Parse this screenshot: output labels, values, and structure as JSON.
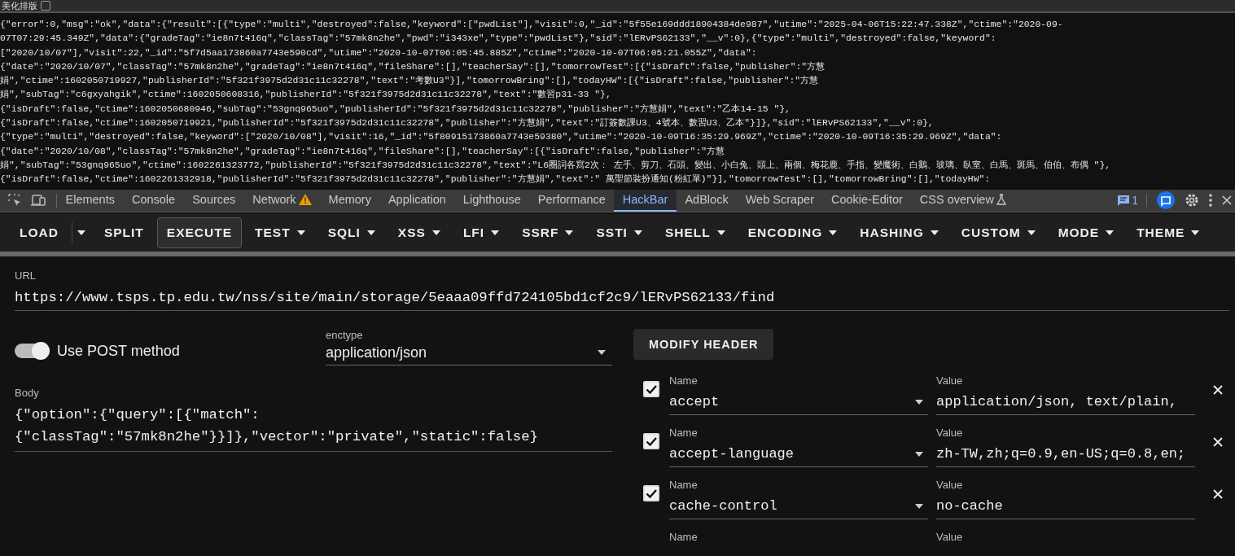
{
  "beautify": {
    "label": "美化排版",
    "checked": false
  },
  "response_lines": [
    "{\"error\":0,\"msg\":\"ok\",\"data\":{\"result\":[{\"type\":\"multi\",\"destroyed\":false,\"keyword\":[\"pwdList\"],\"visit\":0,\"_id\":\"5f55e169ddd18904384de987\",\"utime\":\"2025-04-06T15:22:47.338Z\",\"ctime\":\"2020-09-",
    "07T07:29:45.349Z\",\"data\":{\"gradeTag\":\"ie8n7t416q\",\"classTag\":\"57mk8n2he\",\"pwd\":\"i343xe\",\"type\":\"pwdList\"},\"sid\":\"lERvPS62133\",\"__v\":0},{\"type\":\"multi\",\"destroyed\":false,\"keyword\":",
    "[\"2020/10/07\"],\"visit\":22,\"_id\":\"5f7d5aa173860a7743e590cd\",\"utime\":\"2020-10-07T06:05:45.885Z\",\"ctime\":\"2020-10-07T06:05:21.055Z\",\"data\":",
    "{\"date\":\"2020/10/07\",\"classTag\":\"57mk8n2he\",\"gradeTag\":\"ie8n7t416q\",\"fileShare\":[],\"teacherSay\":[],\"tomorrowTest\":[{\"isDraft\":false,\"publisher\":\"方慧",
    "娟\",\"ctime\":1602050719927,\"publisherId\":\"5f321f3975d2d31c11c32278\",\"text\":\"考數U3\"}],\"tomorrowBring\":[],\"todayHW\":[{\"isDraft\":false,\"publisher\":\"方慧",
    "娟\",\"subTag\":\"c6gxyahgik\",\"ctime\":1602050608316,\"publisherId\":\"5f321f3975d2d31c11c32278\",\"text\":\"數習p31-33 \"},",
    "{\"isDraft\":false,\"ctime\":1602050680946,\"subTag\":\"53gnq965uo\",\"publisherId\":\"5f321f3975d2d31c11c32278\",\"publisher\":\"方慧娟\",\"text\":\"乙本14-15 \"},",
    "{\"isDraft\":false,\"ctime\":1602050719921,\"publisherId\":\"5f321f3975d2d31c11c32278\",\"publisher\":\"方慧娟\",\"text\":\"訂簽數課U3、4號本、數習U3、乙本\"}]},\"sid\":\"lERvPS62133\",\"__v\":0},",
    "{\"type\":\"multi\",\"destroyed\":false,\"keyword\":[\"2020/10/08\"],\"visit\":16,\"_id\":\"5f80915173860a7743e59380\",\"utime\":\"2020-10-09T16:35:29.969Z\",\"ctime\":\"2020-10-09T16:35:29.969Z\",\"data\":",
    "{\"date\":\"2020/10/08\",\"classTag\":\"57mk8n2he\",\"gradeTag\":\"ie8n7t416q\",\"fileShare\":[],\"teacherSay\":[{\"isDraft\":false,\"publisher\":\"方慧",
    "娟\",\"subTag\":\"53gnq965uo\",\"ctime\":1602261323772,\"publisherId\":\"5f321f3975d2d31c11c32278\",\"text\":\"L6圈詞各寫2次： 左手、剪刀、石頭、變出、小白兔、頭上、兩個、梅花鹿、手指、變魔術、白鵝、玻璃、臥室、白馬、斑馬、伯伯、布偶 \"},",
    "{\"isDraft\":false,\"ctime\":1602261332918,\"publisherId\":\"5f321f3975d2d31c11c32278\",\"publisher\":\"方慧娟\",\"text\":\" 萬聖節裝扮通知(粉紅單)\"}],\"tomorrowTest\":[],\"tomorrowBring\":[],\"todayHW\":"
  ],
  "devtools_tabs": [
    {
      "label": "Elements",
      "kind": "plain",
      "selected": false
    },
    {
      "label": "Console",
      "kind": "plain",
      "selected": false
    },
    {
      "label": "Sources",
      "kind": "plain",
      "selected": false
    },
    {
      "label": "Network",
      "kind": "warning",
      "selected": false
    },
    {
      "label": "Memory",
      "kind": "plain",
      "selected": false
    },
    {
      "label": "Application",
      "kind": "plain",
      "selected": false
    },
    {
      "label": "Lighthouse",
      "kind": "plain",
      "selected": false
    },
    {
      "label": "Performance",
      "kind": "plain",
      "selected": false
    },
    {
      "label": "HackBar",
      "kind": "plain",
      "selected": true
    },
    {
      "label": "AdBlock",
      "kind": "plain",
      "selected": false
    },
    {
      "label": "Web Scraper",
      "kind": "plain",
      "selected": false
    },
    {
      "label": "Cookie-Editor",
      "kind": "plain",
      "selected": false
    },
    {
      "label": "CSS overview",
      "kind": "experimental",
      "selected": false
    }
  ],
  "issues_count": "1",
  "toolbar": [
    {
      "label": "LOAD",
      "kind": "button",
      "highlighted": false
    },
    {
      "kind": "menu-caret",
      "highlighted": false
    },
    {
      "label": "SPLIT",
      "kind": "button",
      "highlighted": false
    },
    {
      "label": "EXECUTE",
      "kind": "button",
      "highlighted": true
    },
    {
      "label": "TEST",
      "kind": "dropdown",
      "highlighted": false
    },
    {
      "label": "SQLI",
      "kind": "dropdown",
      "highlighted": false
    },
    {
      "label": "XSS",
      "kind": "dropdown",
      "highlighted": false
    },
    {
      "label": "LFI",
      "kind": "dropdown",
      "highlighted": false
    },
    {
      "label": "SSRF",
      "kind": "dropdown",
      "highlighted": false
    },
    {
      "label": "SSTI",
      "kind": "dropdown",
      "highlighted": false
    },
    {
      "label": "SHELL",
      "kind": "dropdown",
      "highlighted": false
    },
    {
      "label": "ENCODING",
      "kind": "dropdown",
      "highlighted": false
    },
    {
      "label": "HASHING",
      "kind": "dropdown",
      "highlighted": false
    },
    {
      "label": "CUSTOM",
      "kind": "dropdown",
      "highlighted": false
    },
    {
      "label": "MODE",
      "kind": "dropdown",
      "highlighted": false
    },
    {
      "label": "THEME",
      "kind": "dropdown",
      "highlighted": false
    }
  ],
  "url": {
    "label": "URL",
    "value": "https://www.tsps.tp.edu.tw/nss/site/main/storage/5eaaa09ffd724105bd1cf2c9/lERvPS62133/find"
  },
  "post_method": {
    "label": "Use POST method",
    "on": true
  },
  "enctype": {
    "label": "enctype",
    "value": "application/json"
  },
  "modify_header_button": "MODIFY HEADER",
  "body": {
    "label": "Body",
    "value": "{\"option\":{\"query\":[{\"match\":\n{\"classTag\":\"57mk8n2he\"}}]},\"vector\":\"private\",\"static\":false}"
  },
  "headers": [
    {
      "checked": true,
      "name_label": "Name",
      "name": "accept",
      "value_label": "Value",
      "value": "application/json, text/plain,"
    },
    {
      "checked": true,
      "name_label": "Name",
      "name": "accept-language",
      "value_label": "Value",
      "value": "zh-TW,zh;q=0.9,en-US;q=0.8,en;"
    },
    {
      "checked": true,
      "name_label": "Name",
      "name": "cache-control",
      "value_label": "Value",
      "value": "no-cache"
    },
    {
      "name_label": "Name",
      "value_label": "Value"
    }
  ]
}
